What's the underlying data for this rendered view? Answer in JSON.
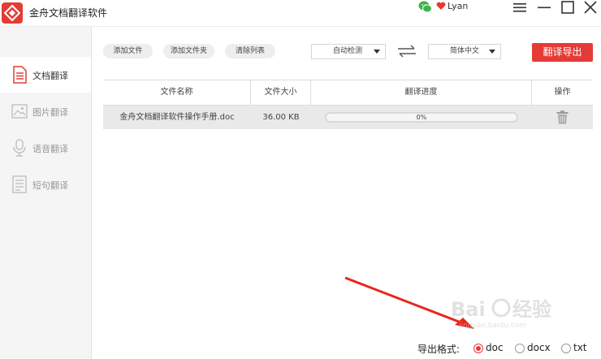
{
  "app": {
    "title": "金舟文档翻译软件",
    "user_name": "Lyan",
    "accent_color": "#e53b36"
  },
  "sidebar": {
    "items": [
      {
        "label": "文档翻译",
        "icon": "document-icon",
        "active": true
      },
      {
        "label": "图片翻译",
        "icon": "image-icon",
        "active": false
      },
      {
        "label": "语音翻译",
        "icon": "microphone-icon",
        "active": false
      },
      {
        "label": "短句翻译",
        "icon": "text-lines-icon",
        "active": false
      }
    ]
  },
  "toolbar": {
    "add_file": "添加文件",
    "add_folder": "添加文件夹",
    "clear_list": "清除列表",
    "source_lang": "自动检测",
    "target_lang": "简体中文",
    "export_label": "翻译导出"
  },
  "table": {
    "headers": [
      "文件名称",
      "文件大小",
      "翻译进度",
      "操作"
    ],
    "rows": [
      {
        "name": "金舟文档翻译软件操作手册.doc",
        "size": "36.00 KB",
        "progress_text": "0%",
        "progress": 0
      }
    ]
  },
  "export_format": {
    "label": "导出格式:",
    "options": [
      {
        "label": "doc",
        "checked": true
      },
      {
        "label": "docx",
        "checked": false
      },
      {
        "label": "txt",
        "checked": false
      }
    ]
  }
}
